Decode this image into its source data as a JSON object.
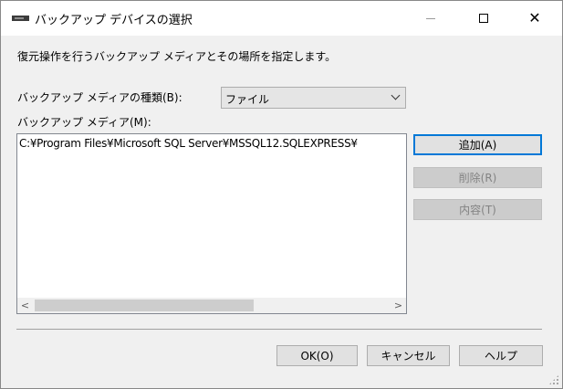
{
  "window": {
    "title": "バックアップ デバイスの選択",
    "icon": "tape-drive-icon"
  },
  "instruction": "復元操作を行うバックアップ メディアとその場所を指定します。",
  "media_type": {
    "label": "バックアップ メディアの種類(B):",
    "selected": "ファイル"
  },
  "media_list": {
    "label": "バックアップ メディア(M):",
    "items": [
      "C:¥Program Files¥Microsoft SQL Server¥MSSQL12.SQLEXPRESS¥"
    ]
  },
  "side_buttons": {
    "add": "追加(A)",
    "remove": "削除(R)",
    "contents": "内容(T)"
  },
  "footer_buttons": {
    "ok": "OK(O)",
    "cancel": "キャンセル",
    "help": "ヘルプ"
  },
  "colors": {
    "accent": "#0078d7",
    "dialog_bg": "#f0f0f0",
    "disabled_text": "#838383"
  }
}
